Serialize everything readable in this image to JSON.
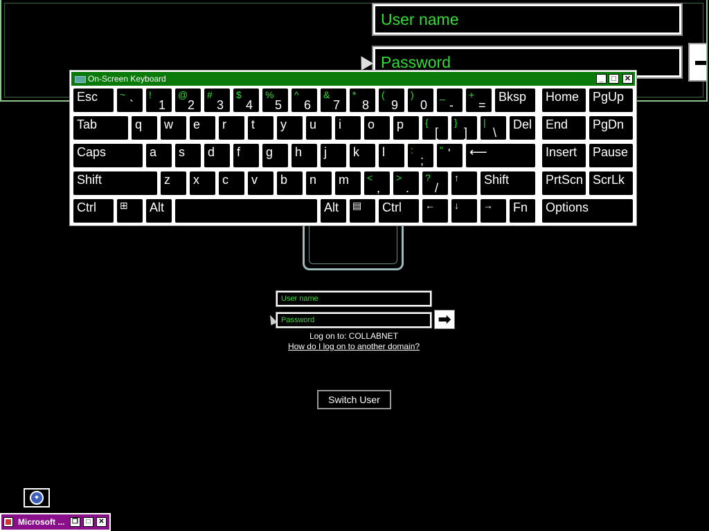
{
  "magnifier": {
    "username_placeholder": "User name",
    "password_placeholder": "Password"
  },
  "osk": {
    "title": "On-Screen Keyboard",
    "min_label": "_",
    "max_label": "□",
    "close_label": "✕",
    "keys": {
      "esc": "Esc",
      "bksp": "Bksp",
      "home": "Home",
      "pgup": "PgUp",
      "tab": "Tab",
      "del": "Del",
      "end": "End",
      "pgdn": "PgDn",
      "caps": "Caps",
      "insert": "Insert",
      "pause": "Pause",
      "shift": "Shift",
      "prtscn": "PrtScn",
      "scrlk": "ScrLk",
      "ctrl": "Ctrl",
      "alt": "Alt",
      "fn": "Fn",
      "options": "Options",
      "tilde_sh": "~",
      "tilde": "`",
      "k1_sh": "!",
      "k1": "1",
      "k2_sh": "@",
      "k2": "2",
      "k3_sh": "#",
      "k3": "3",
      "k4_sh": "$",
      "k4": "4",
      "k5_sh": "%",
      "k5": "5",
      "k6_sh": "^",
      "k6": "6",
      "k7_sh": "&",
      "k7": "7",
      "k8_sh": "*",
      "k8": "8",
      "k9_sh": "(",
      "k9": "9",
      "k0_sh": ")",
      "k0": "0",
      "minus_sh": "_",
      "minus": "-",
      "eq_sh": "+",
      "eq": "=",
      "q": "q",
      "w": "w",
      "e": "e",
      "r": "r",
      "t": "t",
      "y": "y",
      "u": "u",
      "i": "i",
      "o": "o",
      "p": "p",
      "lbr_sh": "{",
      "lbr": "[",
      "rbr_sh": "}",
      "rbr": "]",
      "bsl_sh": "|",
      "bsl": "\\",
      "a": "a",
      "s": "s",
      "d": "d",
      "f": "f",
      "g": "g",
      "h": "h",
      "j": "j",
      "k": "k",
      "l": "l",
      "semi_sh": ":",
      "semi": ";",
      "quote_sh": "\"",
      "quote": "'",
      "enter": "⟵",
      "z": "z",
      "x": "x",
      "c": "c",
      "v": "v",
      "b": "b",
      "n": "n",
      "m": "m",
      "comma_sh": "<",
      "comma": ",",
      "period_sh": ">",
      "period": ".",
      "slash_sh": "?",
      "slash": "/",
      "up": "↑",
      "left": "←",
      "down": "↓",
      "right": "→",
      "win": "⊞",
      "menu": "▤"
    }
  },
  "logon": {
    "username_placeholder": "User name",
    "password_placeholder": "Password",
    "go_label": "➡",
    "logon_to": "Log on to: COLLABNET",
    "other_domain_link": "How do I log on to another domain?",
    "switch_user": "Switch User"
  },
  "taskbar": {
    "item_label": "Microsoft ...",
    "accessibility_icon": "ease-of-access-icon"
  }
}
